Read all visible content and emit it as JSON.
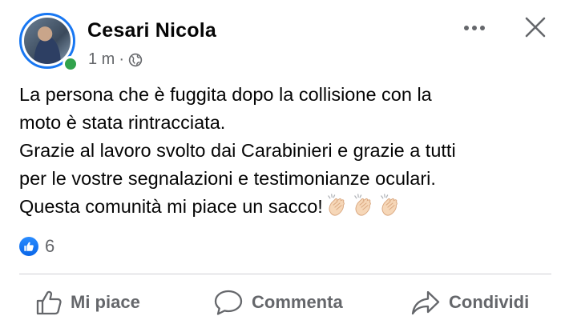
{
  "post": {
    "author": "Cesari Nicola",
    "time": "1 m",
    "separator": "·",
    "text_lines": [
      "La persona che è fuggita dopo la collisione con la",
      "moto è stata rintracciata.",
      "Grazie al lavoro svolto dai Carabinieri e grazie a tutti",
      "per le vostre segnalazioni e testimonianze oculari.",
      "Questa comunità mi piace un sacco!"
    ],
    "emoji": [
      "clapping-hands",
      "clapping-hands",
      "clapping-hands"
    ],
    "reaction_type": "like",
    "reaction_count": "6"
  },
  "actions": {
    "like": "Mi piace",
    "comment": "Commenta",
    "share": "Condividi"
  },
  "colors": {
    "accent": "#1877f2",
    "online": "#31a24c",
    "secondary_text": "#65676b",
    "divider": "#ced0d4"
  }
}
